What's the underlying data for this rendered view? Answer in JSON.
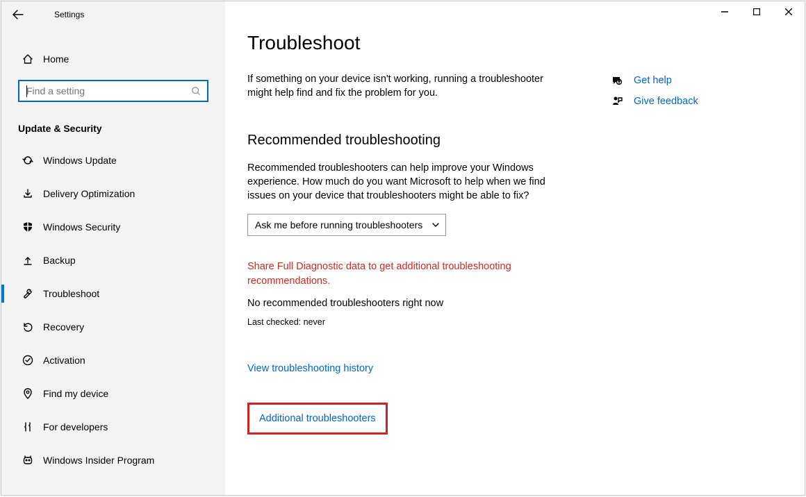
{
  "app_title": "Settings",
  "home_label": "Home",
  "search": {
    "placeholder": "Find a setting"
  },
  "section_title": "Update & Security",
  "nav": [
    {
      "label": "Windows Update"
    },
    {
      "label": "Delivery Optimization"
    },
    {
      "label": "Windows Security"
    },
    {
      "label": "Backup"
    },
    {
      "label": "Troubleshoot"
    },
    {
      "label": "Recovery"
    },
    {
      "label": "Activation"
    },
    {
      "label": "Find my device"
    },
    {
      "label": "For developers"
    },
    {
      "label": "Windows Insider Program"
    }
  ],
  "page": {
    "title": "Troubleshoot",
    "intro": "If something on your device isn't working, running a troubleshooter might help find and fix the problem for you.",
    "recommended_heading": "Recommended troubleshooting",
    "recommended_body": "Recommended troubleshooters can help improve your Windows experience. How much do you want Microsoft to help when we find issues on your device that troubleshooters might be able to fix?",
    "dropdown_value": "Ask me before running troubleshooters",
    "warning": "Share Full Diagnostic data to get additional troubleshooting recommendations.",
    "no_recommended": "No recommended troubleshooters right now",
    "last_checked": "Last checked: never",
    "history_link": "View troubleshooting history",
    "additional_link": "Additional troubleshooters"
  },
  "right_links": {
    "help": "Get help",
    "feedback": "Give feedback"
  }
}
